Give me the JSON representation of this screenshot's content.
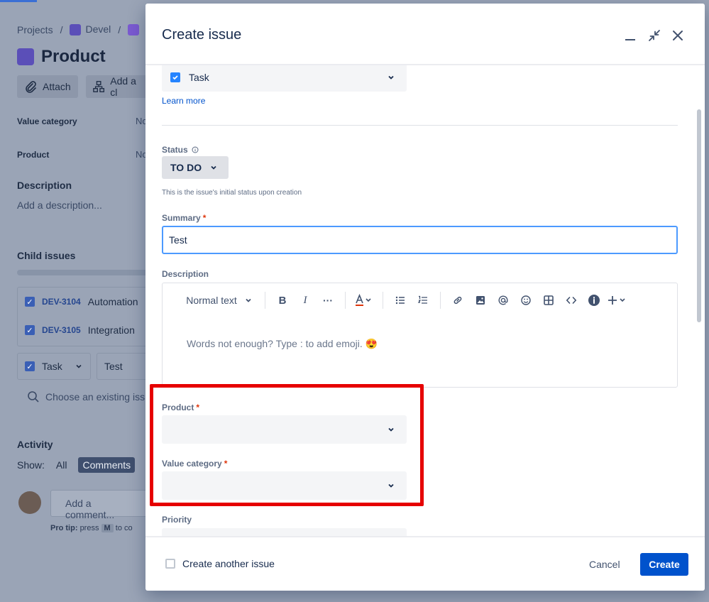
{
  "background": {
    "breadcrumbs": [
      "Projects",
      "/",
      "Devel",
      "/"
    ],
    "issue_title": "Product",
    "attach_label": "Attach",
    "add_child_label": "Add a cl",
    "fields": [
      {
        "label": "Value category",
        "value": "No"
      },
      {
        "label": "Product",
        "value": "No"
      }
    ],
    "description_heading": "Description",
    "description_placeholder": "Add a description...",
    "child_issues_heading": "Child issues",
    "child_issues": [
      {
        "key": "DEV-3104",
        "summary": "Automation"
      },
      {
        "key": "DEV-3105",
        "summary": "Integration"
      }
    ],
    "inline_type": "Task",
    "inline_summary": "Test",
    "choose_existing": "Choose an existing iss",
    "activity_heading": "Activity",
    "show_label": "Show:",
    "show_all": "All",
    "show_comments": "Comments",
    "comment_placeholder": "Add a comment...",
    "pro_tip_bold": "Pro tip:",
    "pro_tip_text": "press",
    "pro_tip_key": "M",
    "pro_tip_rest": "to co"
  },
  "modal": {
    "title": "Create issue",
    "issue_type": "Task",
    "learn_more": "Learn more",
    "status_label": "Status",
    "status_value": "TO DO",
    "status_helper": "This is the issue's initial status upon creation",
    "summary_label": "Summary",
    "summary_value": "Test",
    "description_label": "Description",
    "editor": {
      "text_style": "Normal text",
      "placeholder": "Words not enough? Type : to add emoji. 😍"
    },
    "product_label": "Product",
    "value_category_label": "Value category",
    "priority_label": "Priority",
    "required_marker": "*",
    "create_another": "Create another issue",
    "cancel": "Cancel",
    "create": "Create"
  },
  "colors": {
    "primary": "#0052cc",
    "focus": "#4c9aff",
    "required": "#de350b",
    "highlight": "#e60000"
  }
}
